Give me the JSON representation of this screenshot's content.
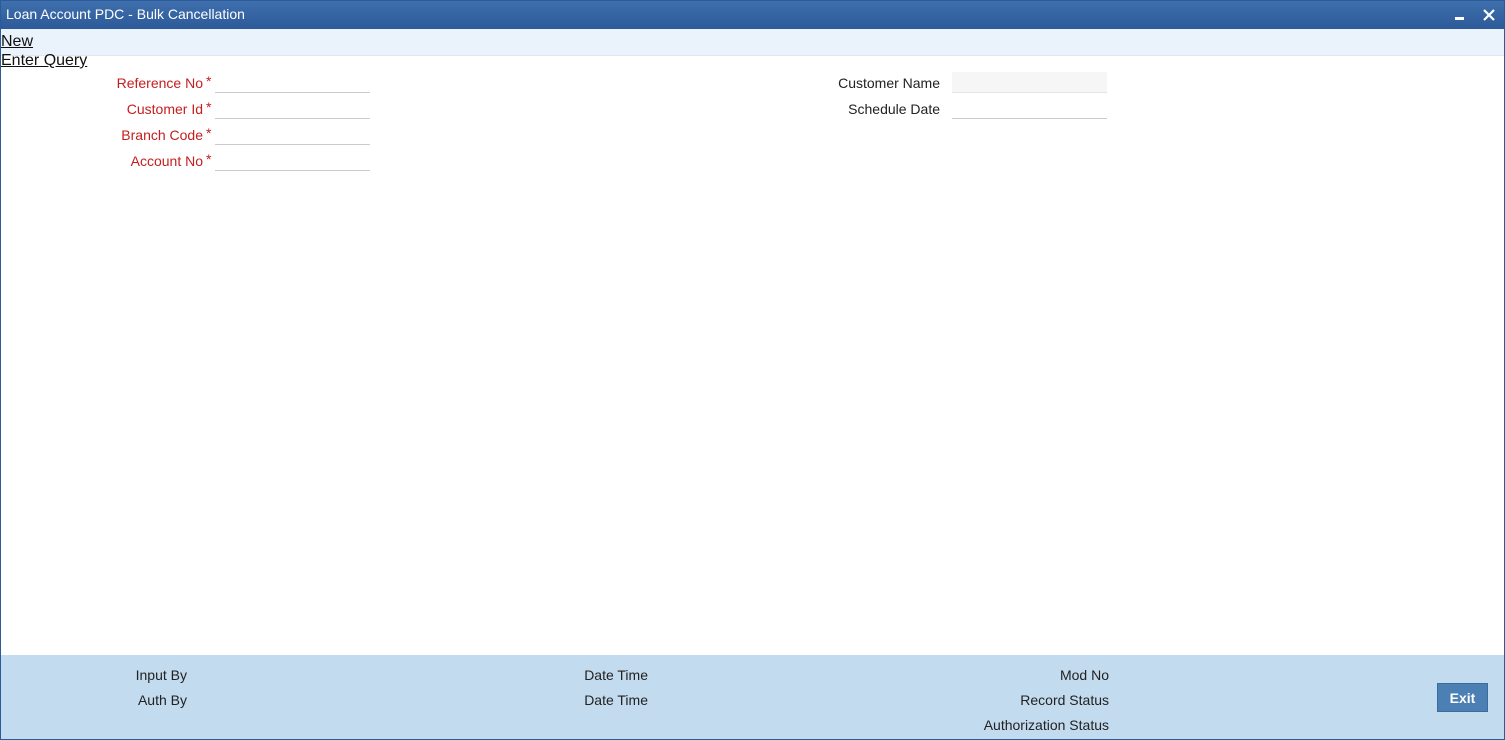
{
  "window": {
    "title": "Loan Account PDC - Bulk Cancellation",
    "minimize_icon": "minimize-icon",
    "close_icon": "close-icon"
  },
  "actions": {
    "new_label": "New",
    "enter_query_label": "Enter Query"
  },
  "form": {
    "required_marker": "*",
    "reference_no": {
      "label": "Reference No",
      "value": ""
    },
    "customer_id": {
      "label": "Customer Id",
      "value": ""
    },
    "branch_code": {
      "label": "Branch Code",
      "value": ""
    },
    "account_no": {
      "label": "Account No",
      "value": ""
    },
    "customer_name": {
      "label": "Customer Name",
      "value": ""
    },
    "schedule_date": {
      "label": "Schedule Date",
      "value": ""
    }
  },
  "footer": {
    "input_by_label": "Input By",
    "auth_by_label": "Auth By",
    "date_time_label_1": "Date Time",
    "date_time_label_2": "Date Time",
    "mod_no_label": "Mod No",
    "record_status_label": "Record Status",
    "authorization_status_label": "Authorization Status",
    "exit_label": "Exit"
  },
  "colors": {
    "titlebar": "#2d5a98",
    "required_label": "#c41e1e",
    "footer_bg": "#c3dbef",
    "exit_button": "#4c7fb3"
  }
}
